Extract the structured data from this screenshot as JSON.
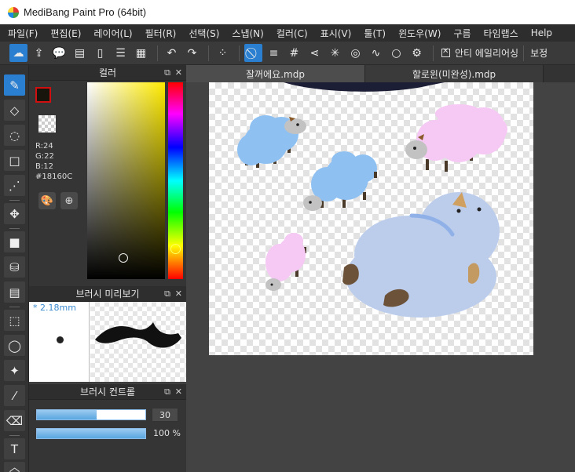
{
  "window": {
    "title": "MediBang Paint Pro (64bit)"
  },
  "menu": [
    "파일(F)",
    "편집(E)",
    "레이어(L)",
    "필터(R)",
    "선택(S)",
    "스냅(N)",
    "컬러(C)",
    "표시(V)",
    "툴(T)",
    "윈도우(W)",
    "구름",
    "타임랩스",
    "Help"
  ],
  "toolbar": {
    "antialias_label": "안티 에일리어싱",
    "correction_label": "보정"
  },
  "color_panel": {
    "title": "컬러",
    "r": "R:24",
    "g": "G:22",
    "b": "B:12",
    "hex": "#18160C",
    "foreground_color": "#18160c"
  },
  "brush_preview": {
    "title": "브러시 미리보기",
    "size": "2.18mm"
  },
  "brush_control": {
    "title": "브러시 컨트롤",
    "size_value": "30",
    "size_fraction": 0.55,
    "opacity_value": "100 %",
    "opacity_fraction": 1.0
  },
  "documents": {
    "tabs": [
      "잘꺼에요.mdp",
      "할로윈(미완성).mdp"
    ],
    "active_index": 0
  },
  "colors": {
    "accent": "#2a7fd0",
    "sheep_blue": "#8ec0f2",
    "sheep_pink": "#f6c8f4",
    "blob": "#bccdec"
  }
}
